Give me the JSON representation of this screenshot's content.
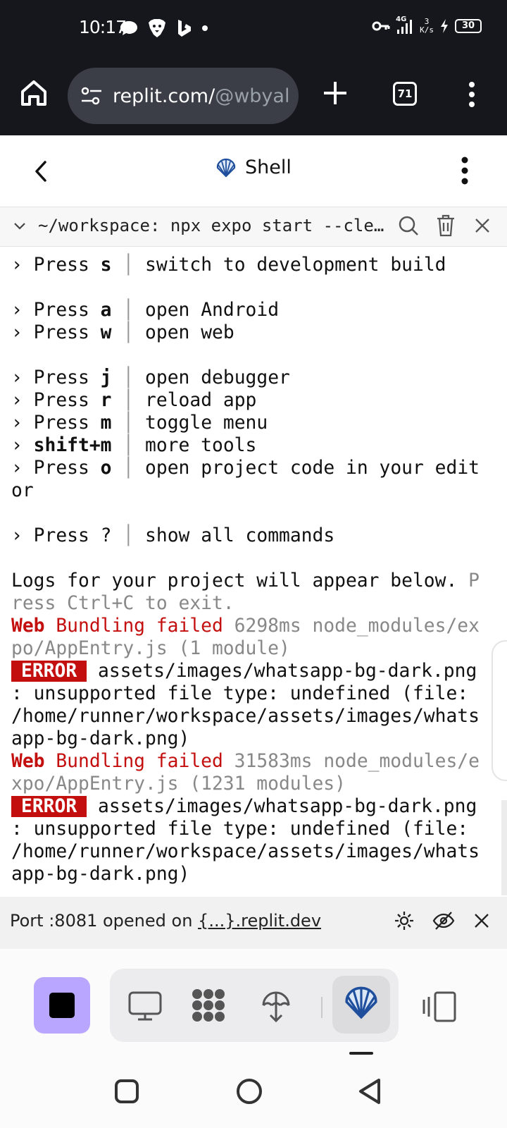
{
  "status_bar": {
    "time": "10:17",
    "network": "4G",
    "net_speed_value": "3",
    "net_speed_unit": "K/s",
    "battery": "30",
    "icons": [
      "chat-bubble-icon",
      "brave-icon",
      "bing-icon",
      "dot-icon",
      "key-icon",
      "signal-icon",
      "charging-icon",
      "battery-icon"
    ]
  },
  "browser": {
    "url_host": "replit.com/",
    "url_path": "@wbyal",
    "tab_count": "71"
  },
  "header": {
    "title": "Shell"
  },
  "command_bar": {
    "text": "~/workspace: npx expo start --cle…"
  },
  "terminal": {
    "lines": [
      {
        "type": "press",
        "prefix": "› ",
        "word": "Press ",
        "key": "s",
        "desc": "switch to development build"
      },
      {
        "type": "blank"
      },
      {
        "type": "press",
        "prefix": "› ",
        "word": "Press ",
        "key": "a",
        "desc": "open Android"
      },
      {
        "type": "press",
        "prefix": "› ",
        "word": "Press ",
        "key": "w",
        "desc": "open web"
      },
      {
        "type": "blank"
      },
      {
        "type": "press",
        "prefix": "› ",
        "word": "Press ",
        "key": "j",
        "desc": "open debugger"
      },
      {
        "type": "press",
        "prefix": "› ",
        "word": "Press ",
        "key": "r",
        "desc": "reload app"
      },
      {
        "type": "press",
        "prefix": "› ",
        "word": "Press ",
        "key": "m",
        "desc": "toggle menu"
      },
      {
        "type": "press",
        "prefix": "› ",
        "word": "",
        "key": "shift+m",
        "desc": "more tools"
      },
      {
        "type": "press",
        "prefix": "› ",
        "word": "Press ",
        "key": "o",
        "desc": "open project code in your edit"
      },
      {
        "type": "text",
        "text": "or"
      },
      {
        "type": "blank"
      },
      {
        "type": "press_plain",
        "prefix": "› ",
        "word": "Press ",
        "key": "?",
        "desc": "show all commands"
      },
      {
        "type": "blank"
      },
      {
        "type": "logs",
        "text": "Logs for your project will appear below. ",
        "dim": "P"
      },
      {
        "type": "dimtext",
        "text": "ress Ctrl+C to exit."
      },
      {
        "type": "bundle",
        "web": "Web",
        "failed": " Bundling failed",
        "rest": " 6298ms node_modules/ex"
      },
      {
        "type": "dimtext",
        "text": "po/AppEntry.js (1 module)"
      },
      {
        "type": "error",
        "badge": "ERROR",
        "text": " assets/images/whatsapp-bg-dark.png"
      },
      {
        "type": "text",
        "text": ": unsupported file type: undefined (file:"
      },
      {
        "type": "text",
        "text": "/home/runner/workspace/assets/images/whats"
      },
      {
        "type": "text",
        "text": "app-bg-dark.png)"
      },
      {
        "type": "bundle",
        "web": "Web",
        "failed": " Bundling failed",
        "rest": " 31583ms node_modules/e"
      },
      {
        "type": "dimtext",
        "text": "xpo/AppEntry.js (1231 modules)"
      },
      {
        "type": "error",
        "badge": "ERROR",
        "text": " assets/images/whatsapp-bg-dark.png"
      },
      {
        "type": "text",
        "text": ": unsupported file type: undefined (file:"
      },
      {
        "type": "text",
        "text": "/home/runner/workspace/assets/images/whats"
      },
      {
        "type": "text",
        "text": "app-bg-dark.png)"
      }
    ]
  },
  "port_bar": {
    "text": "Port :8081 opened on ",
    "link": "{...}.replit.dev"
  },
  "colors": {
    "status_bg": "#15171c",
    "error_red": "#c40f0f",
    "accent_purple": "#b9a6ff",
    "shell_blue": "#1f4f9c"
  }
}
